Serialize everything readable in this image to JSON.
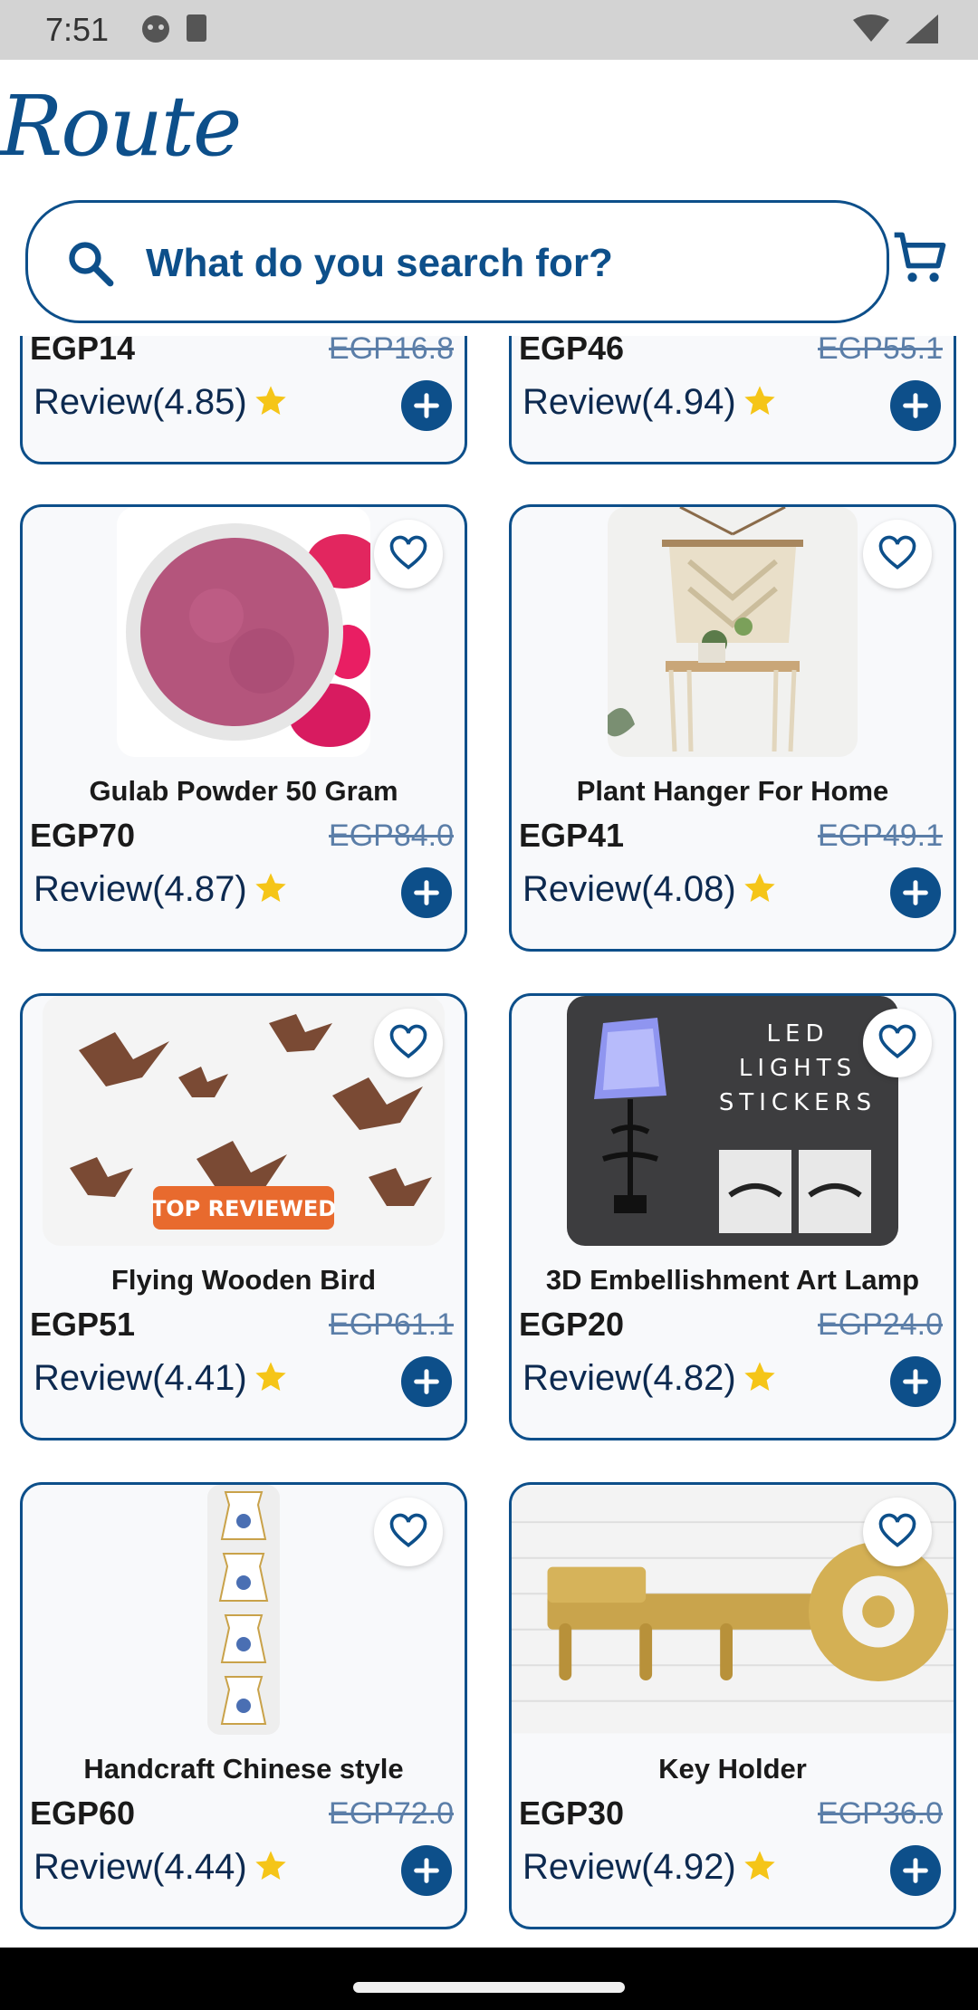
{
  "status_bar": {
    "time": "7:51"
  },
  "header": {
    "logo_text": "Route"
  },
  "search": {
    "placeholder": "What do you search for?"
  },
  "colors": {
    "brand": "#0d4f8a",
    "star": "#f5c518",
    "strike": "#5b7ea8"
  },
  "partial_row": [
    {
      "price": "EGP14",
      "old_price": "EGP16.8",
      "review": "Review(4.85)"
    },
    {
      "price": "EGP46",
      "old_price": "EGP55.1",
      "review": "Review(4.94)"
    }
  ],
  "products": [
    {
      "title": "Gulab Powder 50 Gram",
      "price": "EGP70",
      "old_price": "EGP84.0",
      "review": "Review(4.87)",
      "image": "rose-powder"
    },
    {
      "title": "Plant Hanger For Home",
      "price": "EGP41",
      "old_price": "EGP49.1",
      "review": "Review(4.08)",
      "image": "macrame-shelf"
    },
    {
      "title": "Flying Wooden Bird",
      "price": "EGP51",
      "old_price": "EGP61.1",
      "review": "Review(4.41)",
      "image": "wooden-birds",
      "badge": "TOP REVIEWED"
    },
    {
      "title": "3D Embellishment Art Lamp",
      "price": "EGP20",
      "old_price": "EGP24.0",
      "review": "Review(4.82)",
      "image": "lamp-sticker",
      "image_text": [
        "LED",
        "LIGHTS",
        "STICKERS"
      ]
    },
    {
      "title": "Handcraft Chinese style",
      "price": "EGP60",
      "old_price": "EGP72.0",
      "review": "Review(4.44)",
      "image": "chinese-vases"
    },
    {
      "title": "Key Holder",
      "price": "EGP30",
      "old_price": "EGP36.0",
      "review": "Review(4.92)",
      "image": "brass-key"
    }
  ]
}
